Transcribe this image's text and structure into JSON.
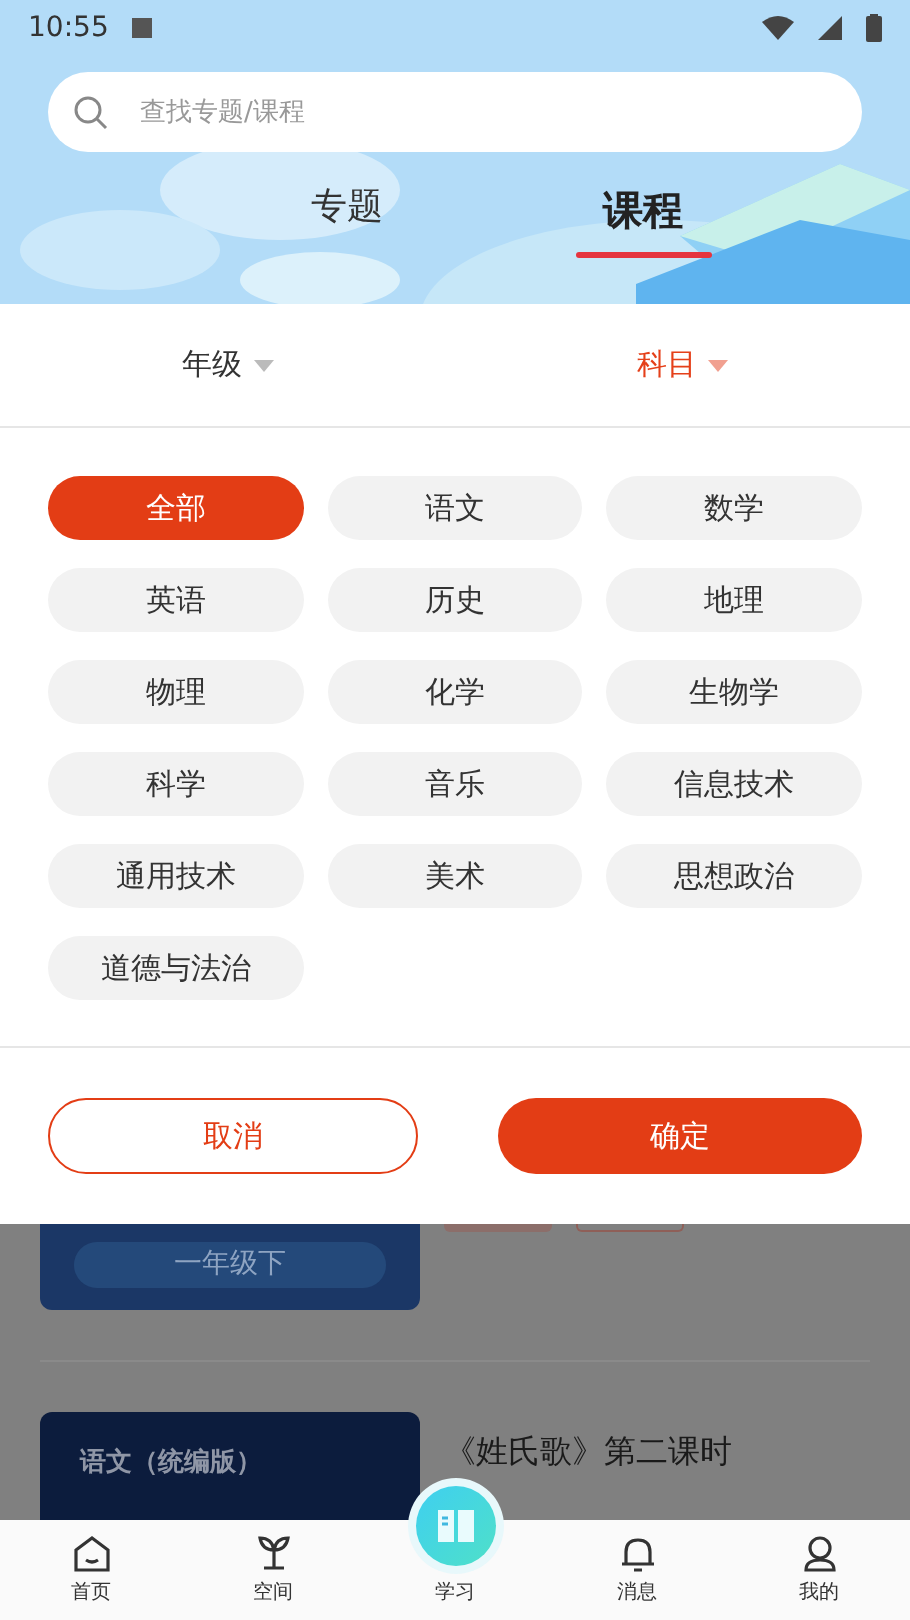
{
  "status_bar": {
    "time": "10:55"
  },
  "search": {
    "placeholder": "查找专题/课程"
  },
  "tabs": [
    {
      "label": "专题",
      "selected": false
    },
    {
      "label": "课程",
      "selected": true
    }
  ],
  "filters": [
    {
      "label": "年级",
      "selected": false
    },
    {
      "label": "科目",
      "selected": true
    }
  ],
  "chips": [
    {
      "label": "全部",
      "selected": true
    },
    {
      "label": "语文",
      "selected": false
    },
    {
      "label": "数学",
      "selected": false
    },
    {
      "label": "英语",
      "selected": false
    },
    {
      "label": "历史",
      "selected": false
    },
    {
      "label": "地理",
      "selected": false
    },
    {
      "label": "物理",
      "selected": false
    },
    {
      "label": "化学",
      "selected": false
    },
    {
      "label": "生物学",
      "selected": false
    },
    {
      "label": "科学",
      "selected": false
    },
    {
      "label": "音乐",
      "selected": false
    },
    {
      "label": "信息技术",
      "selected": false
    },
    {
      "label": "通用技术",
      "selected": false
    },
    {
      "label": "美术",
      "selected": false
    },
    {
      "label": "思想政治",
      "selected": false
    },
    {
      "label": "道德与法治",
      "selected": false
    }
  ],
  "buttons": {
    "cancel": "取消",
    "confirm": "确定"
  },
  "list": [
    {
      "grade": "一年级下"
    },
    {
      "subject": "语文（统编版）",
      "title": "《姓氏歌》第二课时"
    }
  ],
  "nav": [
    {
      "label": "首页",
      "kind": "home"
    },
    {
      "label": "空间",
      "kind": "sprout"
    },
    {
      "label": "学习",
      "kind": "study"
    },
    {
      "label": "消息",
      "kind": "bell"
    },
    {
      "label": "我的",
      "kind": "user"
    }
  ]
}
